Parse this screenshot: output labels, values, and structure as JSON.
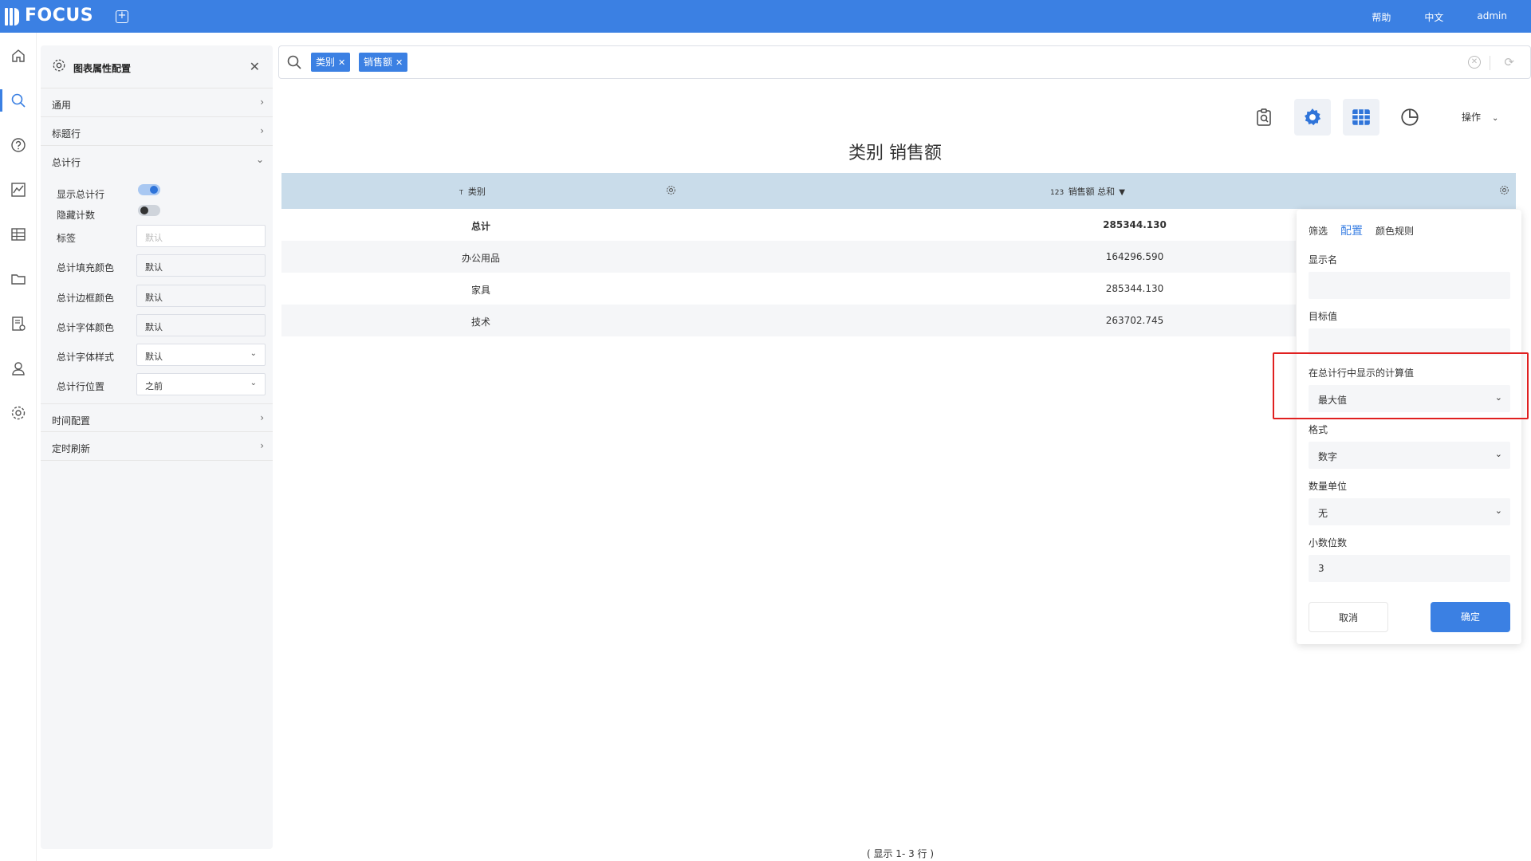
{
  "header": {
    "logo_text": "FOCUS",
    "links": [
      "帮助",
      "中文",
      "admin"
    ]
  },
  "rail": {
    "icons": [
      "home-icon",
      "search-icon",
      "help-icon",
      "chart-icon",
      "table-icon",
      "folder-icon",
      "report-icon",
      "user-icon",
      "settings-icon"
    ],
    "active_index": 1
  },
  "config_panel": {
    "title": "图表属性配置",
    "sections": {
      "general": "通用",
      "title_row": "标题行",
      "total_row": "总计行",
      "time_config": "时间配置",
      "timed_refresh": "定时刷新"
    },
    "total_row": {
      "show_total_label": "显示总计行",
      "show_total_on": true,
      "hide_count_label": "隐藏计数",
      "hide_count_on": false,
      "label_label": "标签",
      "label_placeholder": "默认",
      "fill_color_label": "总计填充颜色",
      "fill_color_value": "默认",
      "border_color_label": "总计边框颜色",
      "border_color_value": "默认",
      "font_color_label": "总计字体颜色",
      "font_color_value": "默认",
      "font_style_label": "总计字体样式",
      "font_style_value": "默认",
      "position_label": "总计行位置",
      "position_value": "之前"
    }
  },
  "search": {
    "chips": [
      "类别",
      "销售额"
    ]
  },
  "toolbar": {
    "operations_label": "操作"
  },
  "chart": {
    "title": "类别 销售额",
    "columns": {
      "category": "类别",
      "category_type": "T",
      "sales": "销售额 总和",
      "sales_type": "123"
    },
    "rows": [
      {
        "category": "总计",
        "sales": "285344.130"
      },
      {
        "category": "办公用品",
        "sales": "164296.590"
      },
      {
        "category": "家具",
        "sales": "285344.130"
      },
      {
        "category": "技术",
        "sales": "263702.745"
      }
    ],
    "footer": "( 显示 1- 3 行 )"
  },
  "popup": {
    "tabs": [
      "筛选",
      "配置",
      "颜色规则"
    ],
    "active_tab": "配置",
    "display_name_label": "显示名",
    "display_name_value": "",
    "target_label": "目标值",
    "target_value": "",
    "calc_label": "在总计行中显示的计算值",
    "calc_value": "最大值",
    "format_label": "格式",
    "format_value": "数字",
    "unit_label": "数量单位",
    "unit_value": "无",
    "decimals_label": "小数位数",
    "decimals_value": "3",
    "cancel_label": "取消",
    "ok_label": "确定"
  },
  "colors": {
    "brand": "#3b80e3",
    "header_row": "#c9dcea",
    "highlight": "#e02020"
  }
}
